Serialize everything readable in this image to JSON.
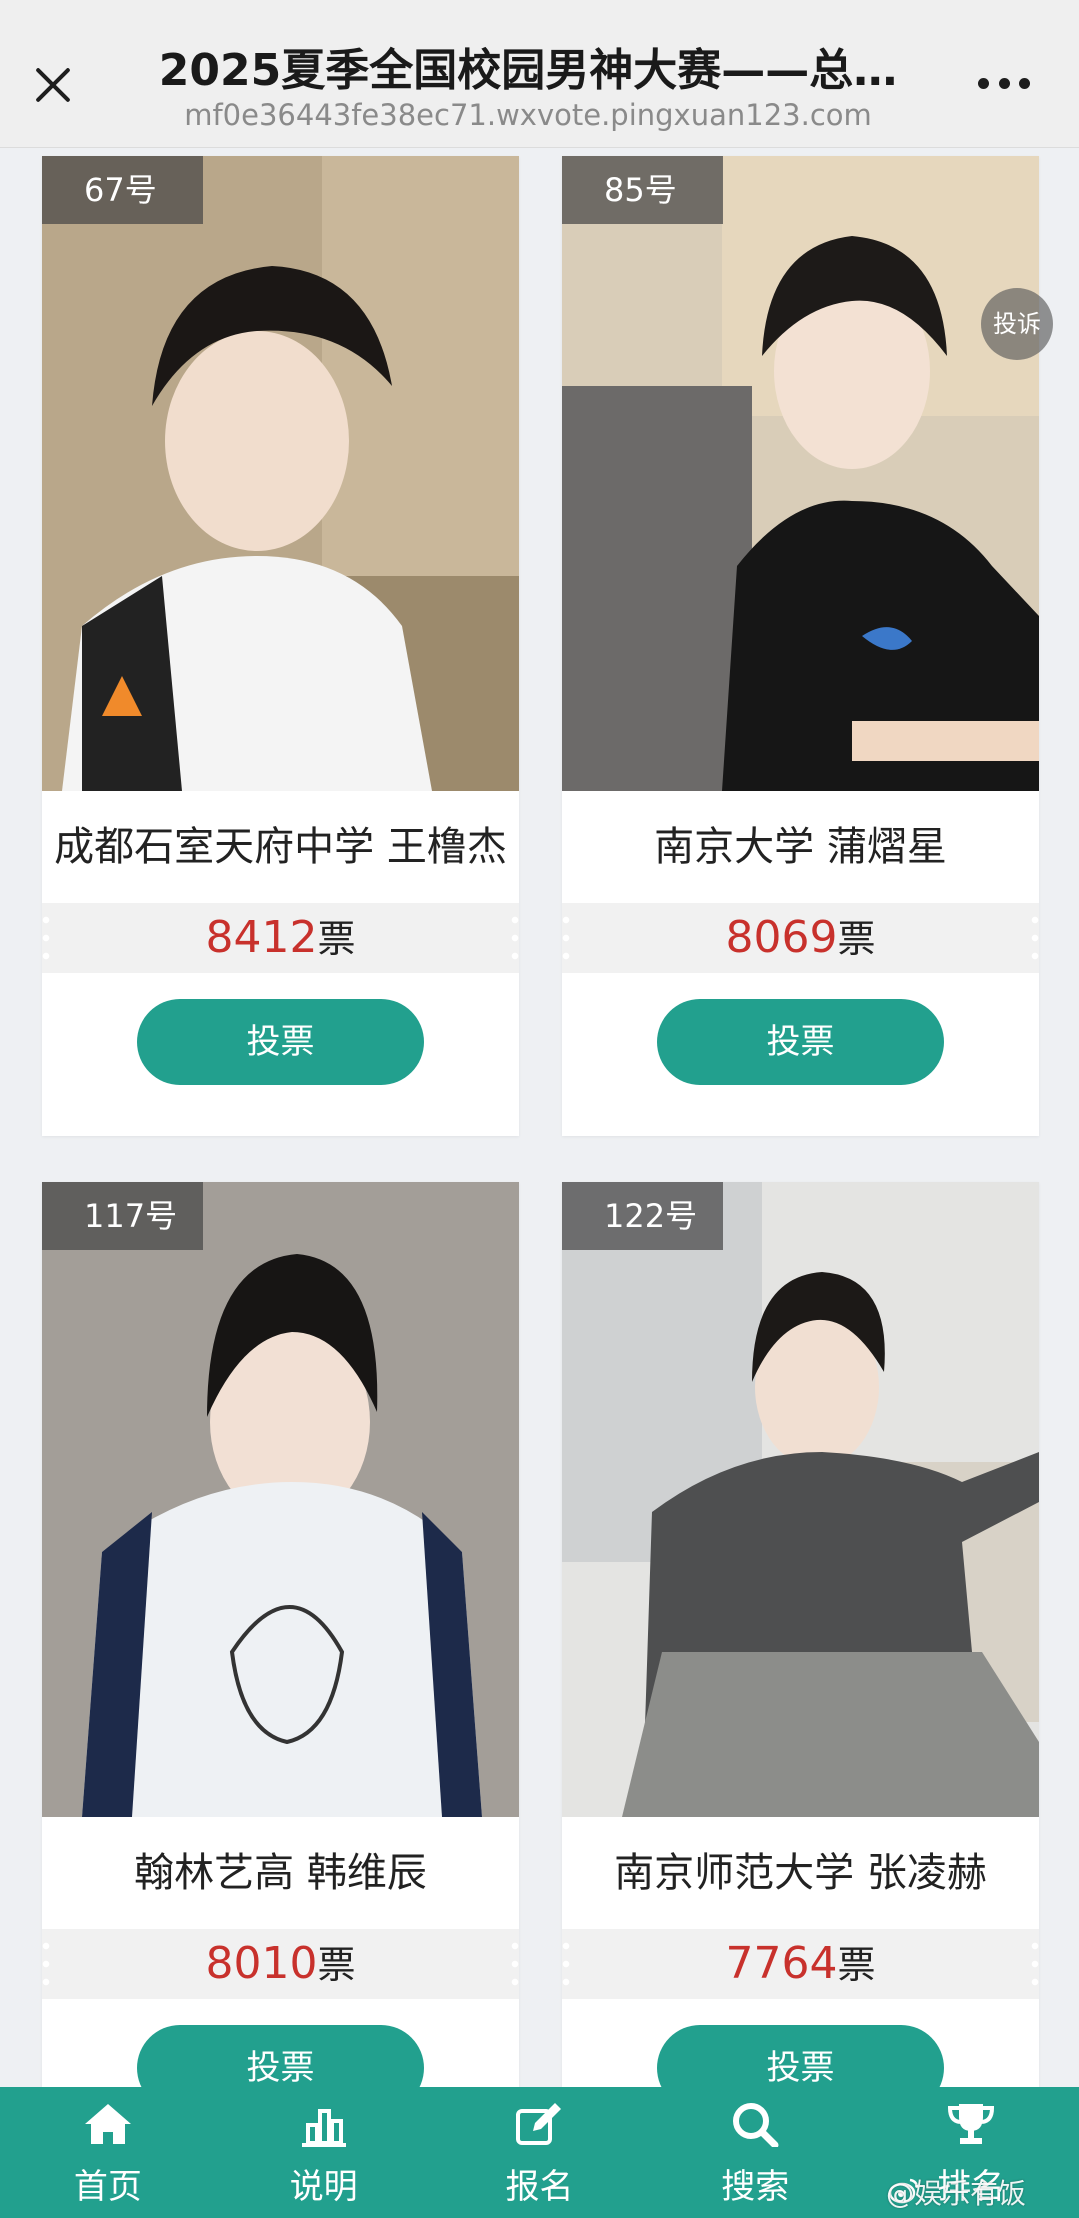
{
  "header": {
    "title": "2025夏季全国校园男神大赛——总…",
    "url": "mf0e36443fe38ec71.wxvote.pingxuan123.com"
  },
  "contestants": [
    {
      "number": "67号",
      "name": "成都石室天府中学 王橹杰",
      "votes": "8412",
      "unit": "票",
      "vote_label": "投票"
    },
    {
      "number": "85号",
      "name": "南京大学 蒲熠星",
      "votes": "8069",
      "unit": "票",
      "vote_label": "投票",
      "complain_label": "投诉"
    },
    {
      "number": "117号",
      "name": "翰林艺高 韩维辰",
      "votes": "8010",
      "unit": "票",
      "vote_label": "投票"
    },
    {
      "number": "122号",
      "name": "南京师范大学 张凌赫",
      "votes": "7764",
      "unit": "票",
      "vote_label": "投票"
    }
  ],
  "nav": {
    "items": [
      {
        "label": "首页",
        "icon": "home-icon"
      },
      {
        "label": "说明",
        "icon": "bar-chart-icon"
      },
      {
        "label": "报名",
        "icon": "edit-icon"
      },
      {
        "label": "搜索",
        "icon": "search-icon"
      },
      {
        "label": "排名",
        "icon": "trophy-icon"
      }
    ]
  },
  "watermark": "@娱乐有饭",
  "colors": {
    "accent": "#22a08e",
    "vote_count": "#c8312c"
  }
}
